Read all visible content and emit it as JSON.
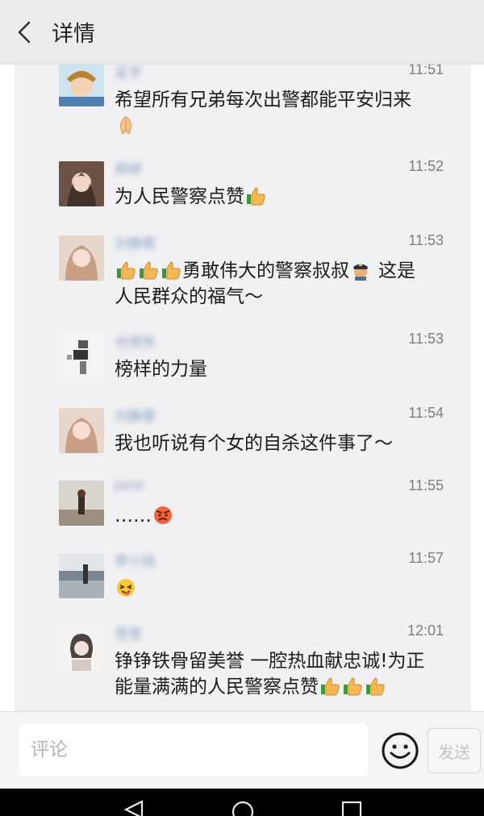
{
  "header": {
    "title": "详情"
  },
  "comments": [
    {
      "name": "孟宇",
      "time": "11:51",
      "line1": "希望所有兄弟每次出警都能平安归来",
      "trail": "",
      "emojis": [
        "folded-hands"
      ]
    },
    {
      "name": "婷婷",
      "time": "11:52",
      "line1": "为人民警察点赞",
      "trail": "",
      "emojis": [
        "thumbs-up"
      ]
    },
    {
      "name": "刘静蓉",
      "time": "11:53",
      "line1": "勇敢伟大的警察叔叔",
      "line2": "这是",
      "line3": "人民群众的福气～",
      "emojis": [
        "thumbs-up",
        "thumbs-up",
        "thumbs-up",
        "police-officer"
      ]
    },
    {
      "name": "也很张",
      "time": "11:53",
      "line1": "榜样的力量",
      "emojis": []
    },
    {
      "name": "刘静蓉",
      "time": "11:54",
      "line1": "我也听说有个女的自杀这件事了～",
      "emojis": []
    },
    {
      "name": "Jane",
      "time": "11:55",
      "line1": "……",
      "emojis": [
        "angry-face"
      ]
    },
    {
      "name": "李小陆",
      "time": "11:57",
      "line1": "",
      "emojis": [
        "squint-tongue-face"
      ]
    },
    {
      "name": "雪莹",
      "time": "12:01",
      "line1": "铮铮铁骨留美誉 一腔热血献忠诚!为正",
      "line2": "能量满满的人民警察点赞",
      "emojis": [
        "thumbs-up",
        "thumbs-up",
        "thumbs-up"
      ]
    }
  ],
  "footer": {
    "placeholder": "评论",
    "send_label": "发送",
    "emoji_button_icon": "smiley-icon"
  },
  "colors": {
    "header_bg": "#ececec",
    "panel_bg": "#f1f1f3",
    "name_color": "#8a9fc4",
    "time_color": "#7e7e7e"
  }
}
